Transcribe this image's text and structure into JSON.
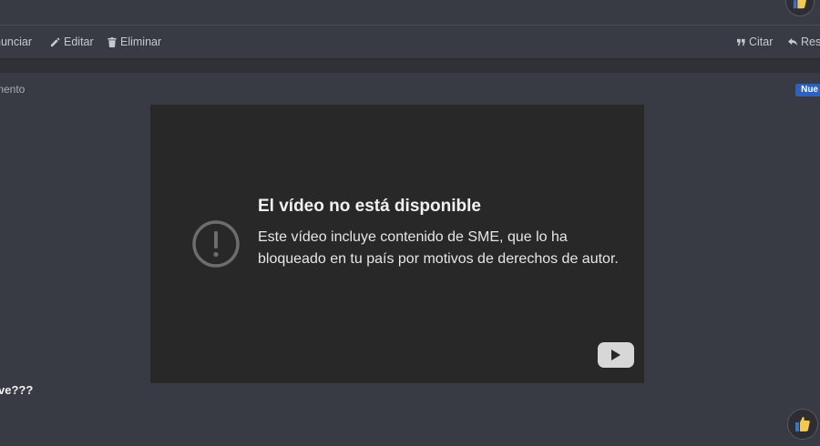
{
  "actions_left": {
    "report": "nunciar",
    "edit": "Editar",
    "delete": "Eliminar"
  },
  "actions_right": {
    "quote": "Citar",
    "reply": "Resp"
  },
  "post": {
    "meta": "mento",
    "badge": "Nue",
    "text": "ve???"
  },
  "video": {
    "title": "El vídeo no está disponible",
    "message": "Este vídeo incluye contenido de SME, que lo ha bloqueado en tu país por motivos de derechos de autor."
  },
  "icons": {
    "edit": "pencil-icon",
    "delete": "trash-icon",
    "quote": "quote-icon",
    "reply": "reply-icon",
    "alert": "alert-circle-icon",
    "play": "youtube-play-icon",
    "reaction": "thumbs-up-icon"
  },
  "colors": {
    "background": "#383b44",
    "video_bg": "#282828",
    "badge": "#2b62c2",
    "reaction_thumb": "#f2c94c",
    "reaction_cuff": "#3b6fd4"
  }
}
